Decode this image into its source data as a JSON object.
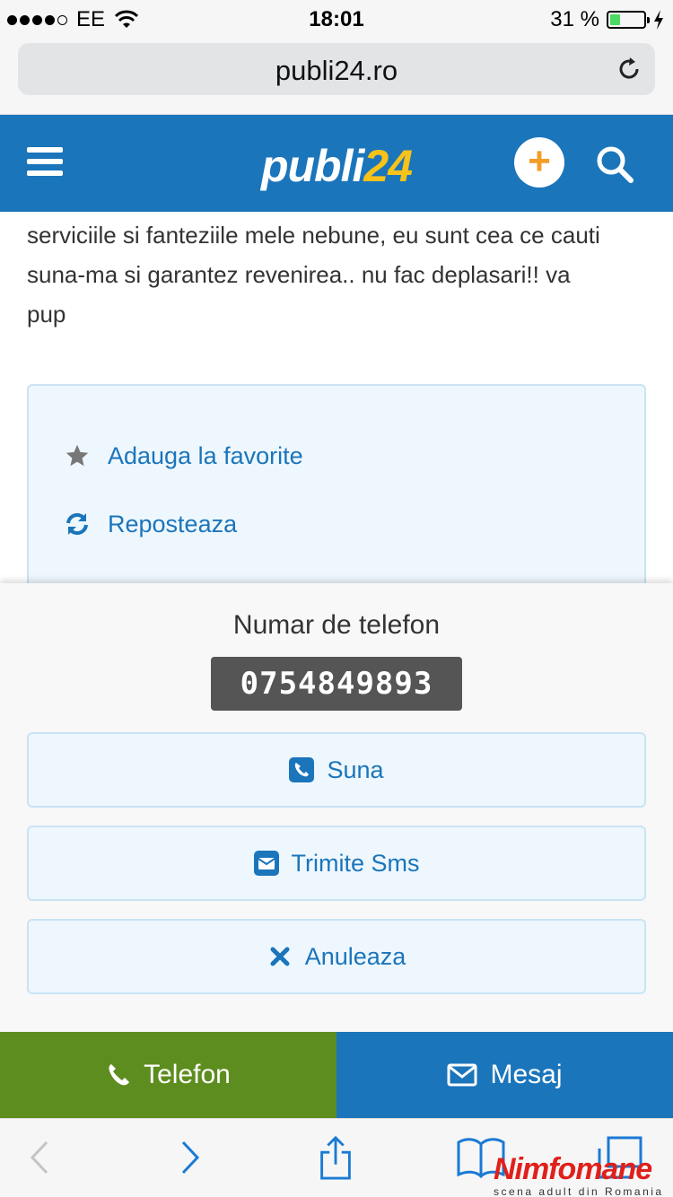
{
  "status_bar": {
    "carrier": "EE",
    "time": "18:01",
    "battery": "31 %",
    "battery_level": 0.31
  },
  "browser": {
    "url": "publi24.ro"
  },
  "header": {
    "logo_text": "publi",
    "logo_num": "24",
    "add_symbol": "+"
  },
  "content": {
    "description_line1": "serviciile si fanteziile mele nebune, eu sunt cea ce cauti",
    "description_line2": "suna-ma si garantez revenirea.. nu fac deplasari!! va",
    "description_line3": "pup",
    "actions": [
      {
        "label": "Adauga la favorite",
        "icon": "star-icon"
      },
      {
        "label": "Reposteaza",
        "icon": "refresh-icon"
      }
    ]
  },
  "phone_sheet": {
    "title": "Numar de telefon",
    "number": "0754849893",
    "call_label": "Suna",
    "sms_label": "Trimite Sms",
    "cancel_label": "Anuleaza"
  },
  "bottom_bar": {
    "phone_label": "Telefon",
    "message_label": "Mesaj"
  },
  "watermark": {
    "title": "Nimfomane",
    "subtitle": "scena adult din Romania"
  },
  "colors": {
    "brand_blue": "#1b75bb",
    "green": "#5e8d1f",
    "accent_yellow": "#f7c21a",
    "accent_orange": "#f39c28"
  }
}
